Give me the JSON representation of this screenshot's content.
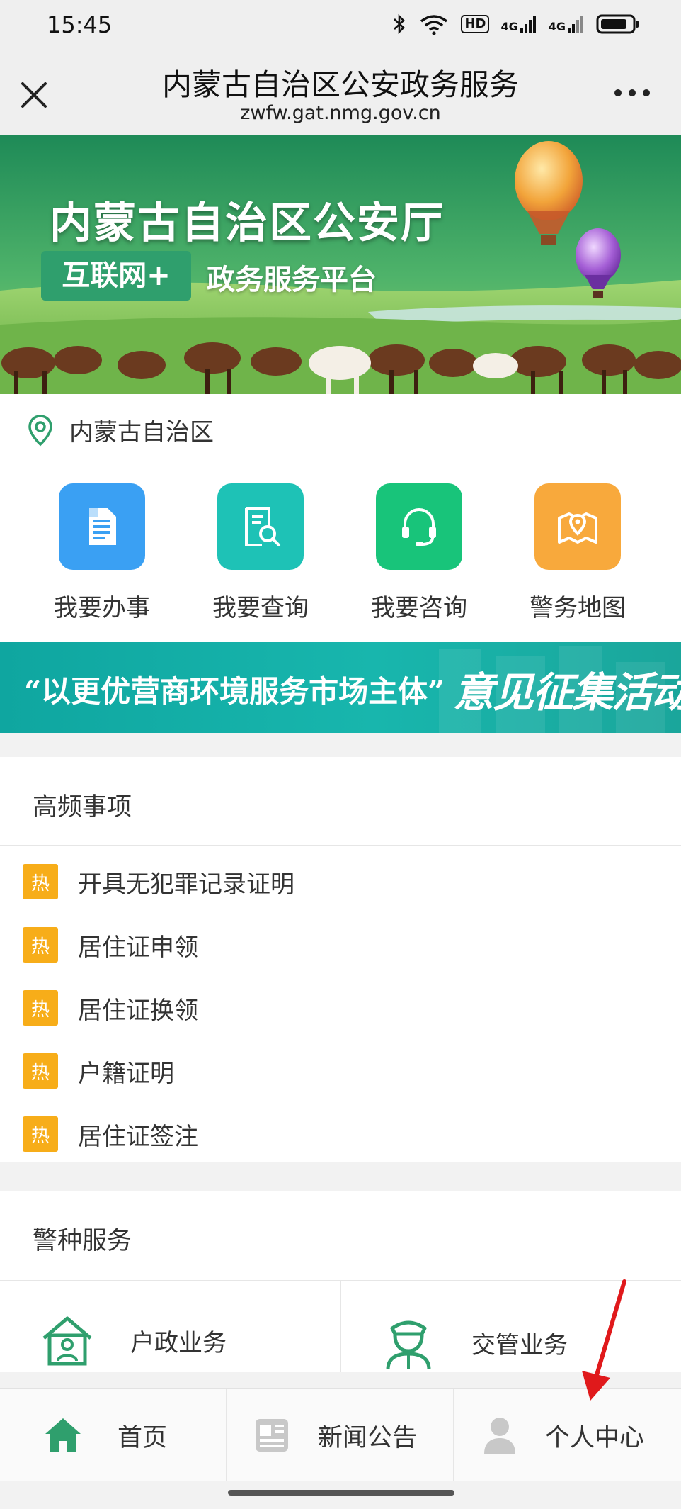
{
  "status_bar": {
    "time": "15:45",
    "network_badge": "HD",
    "signal_1": "4G",
    "signal_2": "4G"
  },
  "title_bar": {
    "title": "内蒙古自治区公安政务服务",
    "url": "zwfw.gat.nmg.gov.cn",
    "close_icon": "close-icon",
    "more_icon": "more-dots-icon"
  },
  "banner": {
    "title": "内蒙古自治区公安厅",
    "badge": "互联网+",
    "subtitle": "政务服务平台"
  },
  "location": {
    "text": "内蒙古自治区"
  },
  "quick_actions": [
    {
      "label": "我要办事",
      "icon": "document-icon",
      "color": "#3aa0f3"
    },
    {
      "label": "我要查询",
      "icon": "search-document-icon",
      "color": "#1ec2b6"
    },
    {
      "label": "我要咨询",
      "icon": "headset-icon",
      "color": "#18c47a"
    },
    {
      "label": "警务地图",
      "icon": "map-icon",
      "color": "#f8a93c"
    }
  ],
  "promo": {
    "text": "“以更优营商环境服务市场主体”",
    "script": "意见征集活动"
  },
  "high_frequency": {
    "title": "高频事项",
    "badge": "热",
    "items": [
      "开具无犯罪记录证明",
      "居住证申领",
      "居住证换领",
      "户籍证明",
      "居住证签注"
    ]
  },
  "police_services": {
    "title": "警种服务",
    "items": [
      {
        "label": "户政业务",
        "icon": "household-icon"
      },
      {
        "label": "交管业务",
        "icon": "traffic-police-icon"
      }
    ]
  },
  "bottom_nav": {
    "items": [
      {
        "label": "首页",
        "icon": "home-icon",
        "active": true
      },
      {
        "label": "新闻公告",
        "icon": "news-icon",
        "active": false
      },
      {
        "label": "个人中心",
        "icon": "user-icon",
        "active": false
      }
    ]
  },
  "colors": {
    "accent_green": "#2f9f6d",
    "hot_badge": "#f7ad19",
    "annotation_arrow": "#e0191b"
  }
}
